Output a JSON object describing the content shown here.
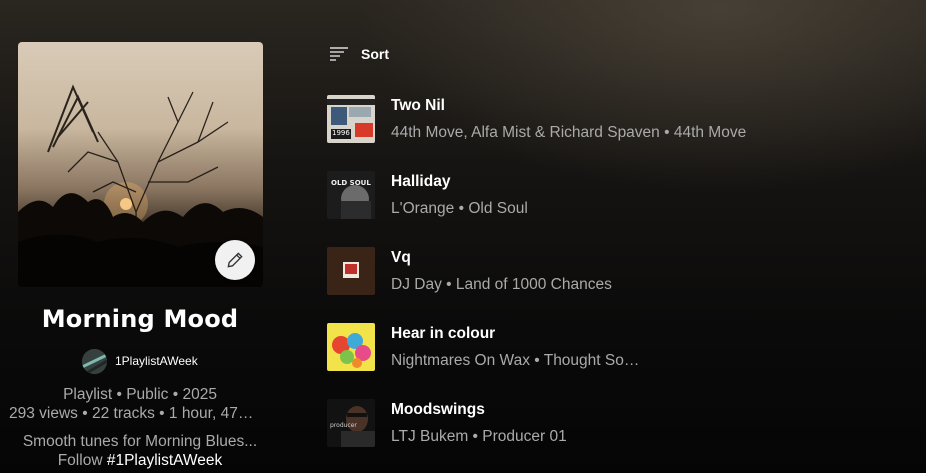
{
  "playlist": {
    "title": "Morning Mood",
    "owner": "1PlaylistAWeek",
    "meta_line1": "Playlist • Public • 2025",
    "meta_line2": "293 views • 22 tracks • 1 hour, 47…",
    "description": "Smooth tunes for Morning Blues...",
    "follow_prefix": "Follow ",
    "follow_tag": "#1PlaylistAWeek"
  },
  "toolbar": {
    "sort_label": "Sort"
  },
  "icons": {
    "edit": "pencil-icon",
    "sort": "sort-lines-icon"
  },
  "tracks": [
    {
      "title": "Two Nil",
      "subtitle": "44th Move, Alfa Mist & Richard Spaven • 44th Move"
    },
    {
      "title": "Halliday",
      "subtitle": "L'Orange • Old Soul"
    },
    {
      "title": "Vq",
      "subtitle": "DJ Day • Land of 1000 Chances"
    },
    {
      "title": "Hear in colour",
      "subtitle": "Nightmares On Wax • Thought So…"
    },
    {
      "title": "Moodswings",
      "subtitle": "LTJ Bukem • Producer 01"
    }
  ],
  "art_text": {
    "two_nil": "1996",
    "halliday": "OLD SOUL",
    "moodswings": "producer"
  }
}
